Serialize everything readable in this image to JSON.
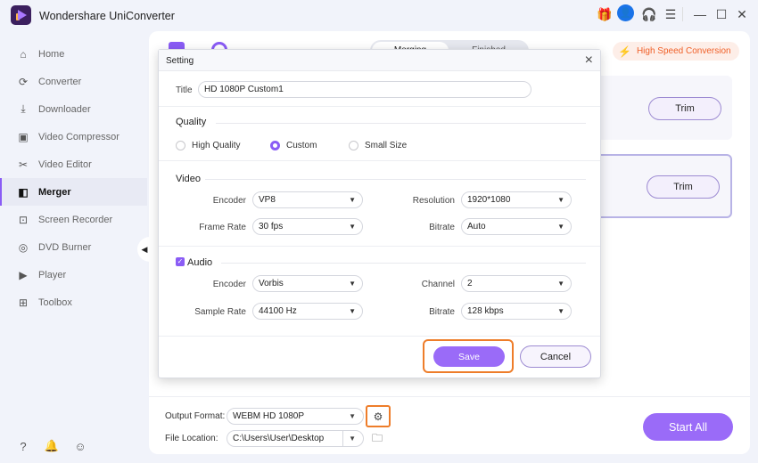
{
  "app": {
    "title": "Wondershare UniConverter",
    "window_controls": [
      "gift-icon",
      "user-icon",
      "headset-icon",
      "menu-icon",
      "minimize-icon",
      "maximize-icon",
      "close-icon"
    ]
  },
  "sidebar": {
    "items": [
      {
        "label": "Home",
        "icon": "home-icon"
      },
      {
        "label": "Converter",
        "icon": "converter-icon"
      },
      {
        "label": "Downloader",
        "icon": "downloader-icon"
      },
      {
        "label": "Video Compressor",
        "icon": "compressor-icon"
      },
      {
        "label": "Video Editor",
        "icon": "scissors-icon"
      },
      {
        "label": "Merger",
        "icon": "merger-icon",
        "active": true
      },
      {
        "label": "Screen Recorder",
        "icon": "screen-recorder-icon"
      },
      {
        "label": "DVD Burner",
        "icon": "dvd-icon"
      },
      {
        "label": "Player",
        "icon": "player-icon"
      },
      {
        "label": "Toolbox",
        "icon": "toolbox-icon"
      }
    ],
    "bottom_icons": [
      "help-icon",
      "bell-icon",
      "feedback-icon"
    ]
  },
  "main": {
    "tabs": [
      {
        "label": "Merging"
      },
      {
        "label": "Finished"
      }
    ],
    "high_speed": "High Speed Conversion",
    "rows": [
      {
        "trim": "Trim"
      },
      {
        "trim": "Trim"
      }
    ],
    "output_format_label": "Output Format:",
    "output_format_value": "WEBM HD 1080P",
    "file_location_label": "File Location:",
    "file_location_value": "C:\\Users\\User\\Desktop",
    "start_all": "Start All"
  },
  "dialog": {
    "title": "Setting",
    "title_label": "Title",
    "title_value": "HD 1080P Custom1",
    "quality": {
      "heading": "Quality",
      "options": [
        "High Quality",
        "Custom",
        "Small Size"
      ],
      "selected": "Custom"
    },
    "video": {
      "heading": "Video",
      "encoder_label": "Encoder",
      "encoder": "VP8",
      "resolution_label": "Resolution",
      "resolution": "1920*1080",
      "frame_rate_label": "Frame Rate",
      "frame_rate": "30 fps",
      "bitrate_label": "Bitrate",
      "bitrate": "Auto"
    },
    "audio": {
      "heading": "Audio",
      "enabled": true,
      "encoder_label": "Encoder",
      "encoder": "Vorbis",
      "channel_label": "Channel",
      "channel": "2",
      "sample_rate_label": "Sample Rate",
      "sample_rate": "44100 Hz",
      "bitrate_label": "Bitrate",
      "bitrate": "128 kbps"
    },
    "save": "Save",
    "cancel": "Cancel"
  },
  "colors": {
    "accent": "#9a6bf8",
    "highlight": "#ee7d2a",
    "high_speed_text": "#f06028"
  }
}
